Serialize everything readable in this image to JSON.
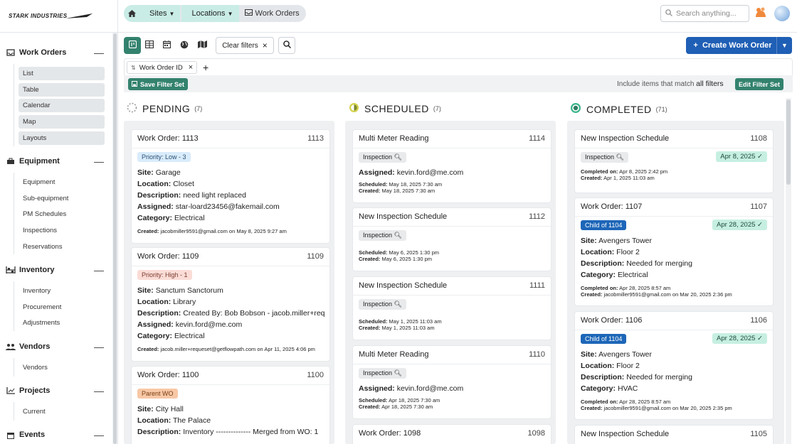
{
  "brand": "STARK INDUSTRIES",
  "breadcrumb": {
    "sites": "Sites",
    "locations": "Locations",
    "current": "Work Orders"
  },
  "search": {
    "placeholder": "Search anything..."
  },
  "sidebar": {
    "work_orders": {
      "label": "Work Orders",
      "items": [
        "List",
        "Table",
        "Calendar",
        "Map",
        "Layouts"
      ]
    },
    "equipment": {
      "label": "Equipment",
      "items": [
        "Equipment",
        "Sub-equipment",
        "PM Schedules",
        "Inspections",
        "Reservations"
      ]
    },
    "inventory": {
      "label": "Inventory",
      "items": [
        "Inventory",
        "Procurement",
        "Adjustments"
      ]
    },
    "vendors": {
      "label": "Vendors",
      "items": [
        "Vendors"
      ]
    },
    "projects": {
      "label": "Projects",
      "items": [
        "Current"
      ]
    },
    "events": {
      "label": "Events"
    }
  },
  "toolbar": {
    "clear_filters": "Clear filters",
    "create": "Create Work Order"
  },
  "filters": {
    "chip": "Work Order ID",
    "save": "Save Filter Set",
    "include_text": "Include items that match",
    "all_filters": "all filters",
    "edit": "Edit Filter Set"
  },
  "columns": {
    "pending": {
      "label": "PENDING",
      "count": "(7)",
      "cards": [
        {
          "title": "Work Order: 1113",
          "num": "1113",
          "tag": "Priority: Low - 3",
          "site": "Garage",
          "location": "Closet",
          "description": "need light replaced",
          "assigned": "star-loard23456@fakemail.com",
          "category": "Electrical",
          "created_label": "Created:",
          "created": "jacobmiller9591@gmail.com on May 8, 2025 9:27 am"
        },
        {
          "title": "Work Order: 1109",
          "num": "1109",
          "tag": "Priority: High - 1",
          "site": "Sanctum Sanctorum",
          "location": "Library",
          "description": "Created By: Bob Bobson - jacob.miller+req",
          "assigned": "kevin.ford@me.com",
          "category": "Electrical",
          "created_label": "Created:",
          "created": "jacob.miller+requeset@getflowpath.com on Apr 11, 2025 4:06 pm"
        },
        {
          "title": "Work Order: 1100",
          "num": "1100",
          "tag": "Parent WO",
          "site": "City Hall",
          "location": "The Palace",
          "description": "Inventory -------------- Merged from WO: 1"
        }
      ]
    },
    "scheduled": {
      "label": "SCHEDULED",
      "count": "(7)",
      "cards": [
        {
          "title": "Multi Meter Reading",
          "num": "1114",
          "tag": "Inspection",
          "assigned": "kevin.ford@me.com",
          "scheduled": "May 18, 2025 7:30 am",
          "created": "May 18, 2025 7:30 am"
        },
        {
          "title": "New Inspection Schedule",
          "num": "1112",
          "tag": "Inspection",
          "scheduled": "May 6, 2025 1:30 pm",
          "created": "May 6, 2025 1:30 pm"
        },
        {
          "title": "New Inspection Schedule",
          "num": "1111",
          "tag": "Inspection",
          "scheduled": "May 1, 2025 11:03 am",
          "created": "May 1, 2025 11:03 am"
        },
        {
          "title": "Multi Meter Reading",
          "num": "1110",
          "tag": "Inspection",
          "assigned": "kevin.ford@me.com",
          "scheduled": "Apr 18, 2025 7:30 am",
          "created": "Apr 18, 2025 7:30 am"
        },
        {
          "title": "Work Order: 1098",
          "num": "1098"
        }
      ]
    },
    "completed": {
      "label": "COMPLETED",
      "count": "(71)",
      "cards": [
        {
          "title": "New Inspection Schedule",
          "num": "1108",
          "tag": "Inspection",
          "date": "Apr 8, 2025",
          "completed": "Apr 8, 2025 2:42 pm",
          "created": "Apr 1, 2025 11:03 am"
        },
        {
          "title": "Work Order: 1107",
          "num": "1107",
          "tag": "Child of 1104",
          "date": "Apr 28, 2025",
          "site": "Avengers Tower",
          "location": "Floor 2",
          "description": "Needed for merging",
          "category": "Electrical",
          "completed": "Apr 28, 2025 8:57 am",
          "created": "jacobmiller9591@gmail.com on Mar 20, 2025 2:36 pm"
        },
        {
          "title": "Work Order: 1106",
          "num": "1106",
          "tag": "Child of 1104",
          "date": "Apr 28, 2025",
          "site": "Avengers Tower",
          "location": "Floor 2",
          "description": "Needed for merging",
          "category": "HVAC",
          "completed": "Apr 28, 2025 8:57 am",
          "created": "jacobmiller9591@gmail.com on Mar 20, 2025 2:35 pm"
        },
        {
          "title": "New Inspection Schedule",
          "num": "1105"
        }
      ]
    }
  },
  "labels": {
    "site": "Site:",
    "location": "Location:",
    "description": "Description:",
    "assigned": "Assigned:",
    "category": "Category:",
    "scheduled": "Scheduled:",
    "created": "Created:",
    "completed": "Completed on:"
  },
  "colors": {
    "accent": "#33826e",
    "primary": "#1f5fb5"
  }
}
